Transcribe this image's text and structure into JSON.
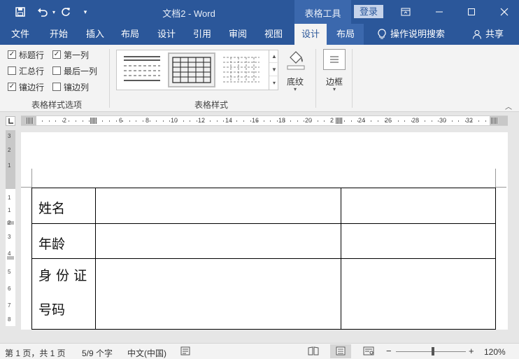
{
  "title_bar": {
    "title": "文档2 - Word",
    "context_tab": "表格工具",
    "login": "登录"
  },
  "menu": {
    "items": [
      "文件",
      "开始",
      "插入",
      "布局",
      "设计",
      "引用",
      "审阅",
      "视图",
      "设计",
      "布局"
    ],
    "active_index": 8,
    "tell_me": "操作说明搜索",
    "share": "共享"
  },
  "ribbon": {
    "style_options": {
      "items": [
        {
          "label": "标题行",
          "checked": true
        },
        {
          "label": "第一列",
          "checked": true
        },
        {
          "label": "汇总行",
          "checked": false
        },
        {
          "label": "最后一列",
          "checked": false
        },
        {
          "label": "镶边行",
          "checked": true
        },
        {
          "label": "镶边列",
          "checked": false
        }
      ],
      "group_label": "表格样式选项"
    },
    "table_styles_label": "表格样式",
    "shading_label": "底纹",
    "borders_label": "边框"
  },
  "ruler": {
    "h_ticks": [
      "2",
      "6",
      "8",
      "10",
      "12",
      "14",
      "16",
      "18",
      "20",
      "2",
      "24",
      "26",
      "28",
      "30",
      "32"
    ],
    "v_ticks": [
      "3",
      "2",
      "1",
      "1",
      "1",
      "2",
      "3",
      "4",
      "5",
      "6",
      "7",
      "8"
    ]
  },
  "document": {
    "rows": [
      {
        "label": "姓名"
      },
      {
        "label": "年龄"
      },
      {
        "label_line1": "身 份 证",
        "label_line2": "号码"
      }
    ]
  },
  "status_bar": {
    "page": "第 1 页，共 1 页",
    "words": "5/9 个字",
    "language": "中文(中国)",
    "zoom": "120%",
    "zoom_level_percent": 120
  }
}
